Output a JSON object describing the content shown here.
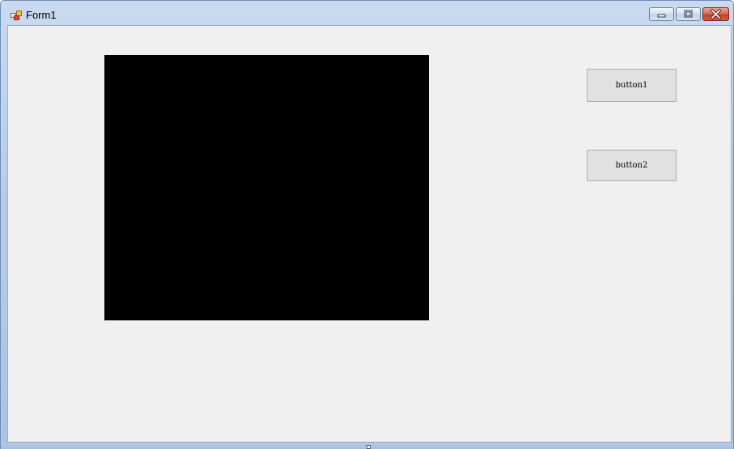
{
  "window": {
    "title": "Form1",
    "icon": "winforms-app-icon"
  },
  "caption_buttons": {
    "minimize_icon": "minimize-icon",
    "maximize_icon": "maximize-icon",
    "close_icon": "close-icon",
    "close_color": "#c2432a"
  },
  "content": {
    "picture_box_color": "#000000",
    "button1_label": "button1",
    "button2_label": "button2"
  }
}
